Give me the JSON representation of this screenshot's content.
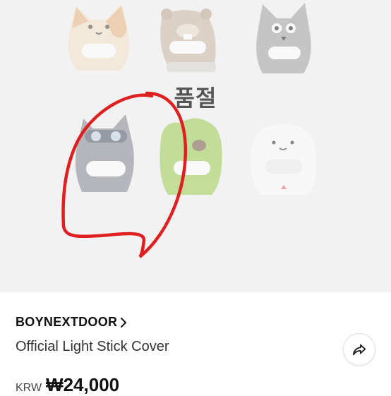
{
  "image": {
    "soldout_label": "품절",
    "items": [
      "cat-cover",
      "beaver-cover",
      "fox-cover",
      "gray-cat-goggles-cover",
      "green-frog-cover",
      "white-ghost-cover"
    ],
    "annotation_color": "#e02020"
  },
  "product": {
    "brand": "BOYNEXTDOOR",
    "title": "Official Light Stick Cover",
    "currency": "KRW",
    "price": "₩24,000"
  },
  "icons": {
    "brand_link": "chevron-right-icon",
    "share": "share-icon"
  }
}
